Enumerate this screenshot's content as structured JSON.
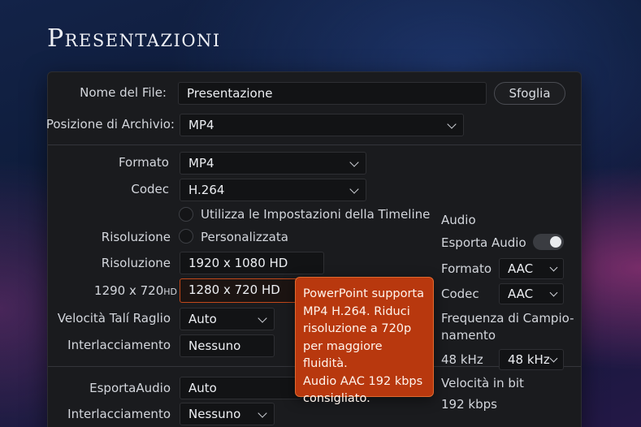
{
  "page_title": "Presentazioni",
  "file": {
    "name_label": "Nome del File:",
    "name_value": "Presentazione",
    "browse_label": "Sfoglia",
    "location_label": "Posizione di Archivio:",
    "location_value": "MP4"
  },
  "video": {
    "format_label": "Formato",
    "format_value": "MP4",
    "codec_label": "Codec",
    "codec_value": "H.264",
    "use_timeline_label": "Utilizza le Impostazioni della Timeline",
    "resolution_radio_label": "Risoluzione",
    "custom_label": "Personalizzata",
    "resolution_label": "Risoluzione",
    "resolution_value": "1920 x 1080 HD",
    "alt_resolution_label_main": "1290 x 720",
    "alt_resolution_label_unit": "HD",
    "alt_resolution_value": "1280 x 720 HD",
    "frame_rate_label": "Velocità Talí Raglio",
    "frame_rate_value": "Auto",
    "interlace_label": "Interlacciamento",
    "interlace_value": "Nessuno"
  },
  "audio_lower": {
    "export_label": "EsportaAudio",
    "export_value": "Auto",
    "interlace_label": "Interlacciamento",
    "interlace_value": "Nessuno"
  },
  "audio": {
    "heading": "Audio",
    "export_label": "Esporta Audio",
    "export_enabled": true,
    "format_label": "Formato",
    "format_value": "AAC",
    "codec_label": "Codec",
    "codec_value": "AAC",
    "sample_rate_label_1": "Frequenza di Campio-",
    "sample_rate_label_2": "namento",
    "sample_rate_text": "48 kHz",
    "sample_rate_value": "48 kHz",
    "bitrate_label": "Velocità in bit",
    "bitrate_value": "192 kbps"
  },
  "tooltip": {
    "lines": [
      "PowerPoint supporta",
      "MP4 H.264. Riduci",
      "risoluzione a 720p",
      "per maggiore fluidità.",
      "Audio AAC 192 kbps",
      "consigliato."
    ]
  },
  "colors": {
    "accent": "#b8380e",
    "panel": "#1a1b1e"
  }
}
